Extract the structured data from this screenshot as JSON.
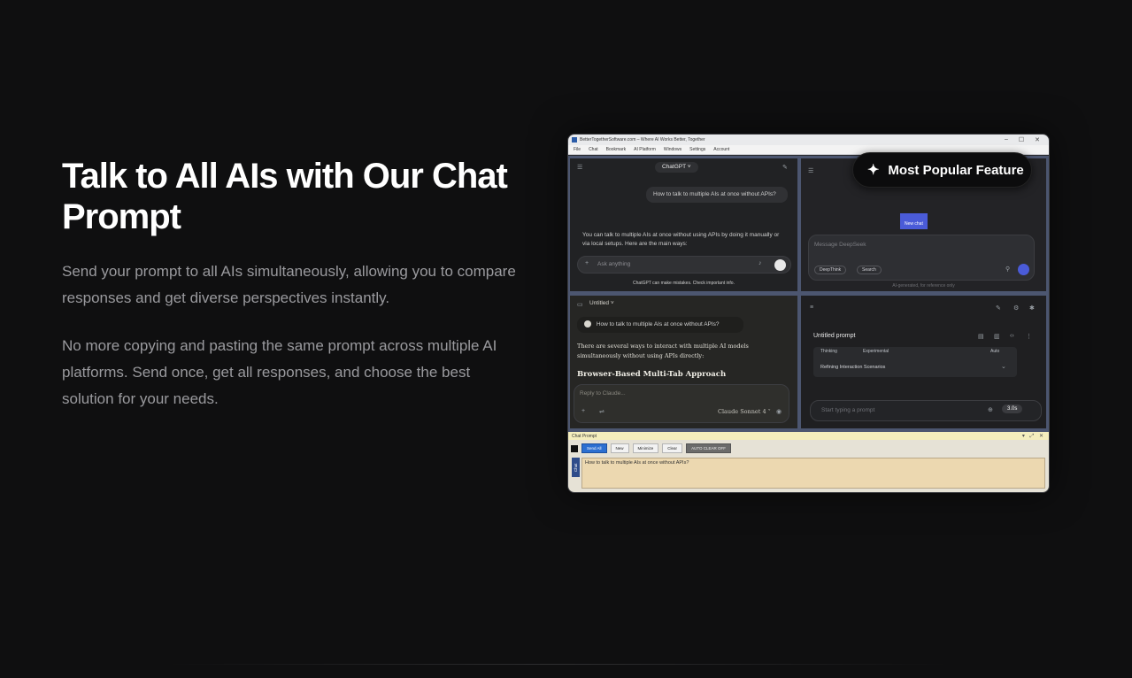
{
  "hero": {
    "title": "Talk to All AIs with Our Chat Prompt",
    "paragraph1": "Send your prompt to all AIs simultaneously, allowing you to compare responses and get diverse perspectives instantly.",
    "paragraph2": "No more copying and pasting the same prompt across multiple AI platforms. Send once, get all responses, and choose the best solution for your needs."
  },
  "badge": {
    "icon": "sparkle-icon",
    "label": "Most Popular Feature"
  },
  "window": {
    "title": "BetterTogetherSoftware.com – Where AI Works Better, Together",
    "menu": [
      "File",
      "Chat",
      "Bookmark",
      "AI Platform",
      "Windows",
      "Settings",
      "Account"
    ]
  },
  "chatgpt": {
    "model": "ChatGPT ˅",
    "user_message": "How to talk to multiple AIs at once without APIs?",
    "response": "You can talk to multiple AIs at once without using APIs by doing it manually or via local setups. Here are the main ways:",
    "placeholder": "Ask anything",
    "disclaimer": "ChatGPT can make mistakes. Check important info."
  },
  "deepseek": {
    "new_chat": "New chat",
    "placeholder": "Message DeepSeek",
    "deepthink": "DeepThink",
    "search": "Search",
    "footer": "AI-generated, for reference only"
  },
  "claude": {
    "title": "Untitled ˅",
    "user_message": "How to talk to multiple AIs at once without APIs?",
    "response": "There are several ways to interact with multiple AI models simultaneously without using APIs directly:",
    "heading": "Browser-Based Multi-Tab Approach",
    "placeholder": "Reply to Claude...",
    "model": "Claude Sonnet 4 ˅"
  },
  "gemini": {
    "title": "Untitled prompt",
    "thinking": "Thinking",
    "experimental": "Experimental",
    "auto": "Auto",
    "section": "Refining Interaction Scenarios",
    "placeholder": "Start typing a prompt",
    "timer": "3.0s"
  },
  "chat_prompt": {
    "header": "Chat Prompt",
    "side_label": "Chat",
    "buttons": [
      "Send All",
      "New",
      "Minimize",
      "Clear",
      "AUTO CLEAR OFF"
    ],
    "text": "How to talk to multiple AIs at once without APIs?"
  }
}
